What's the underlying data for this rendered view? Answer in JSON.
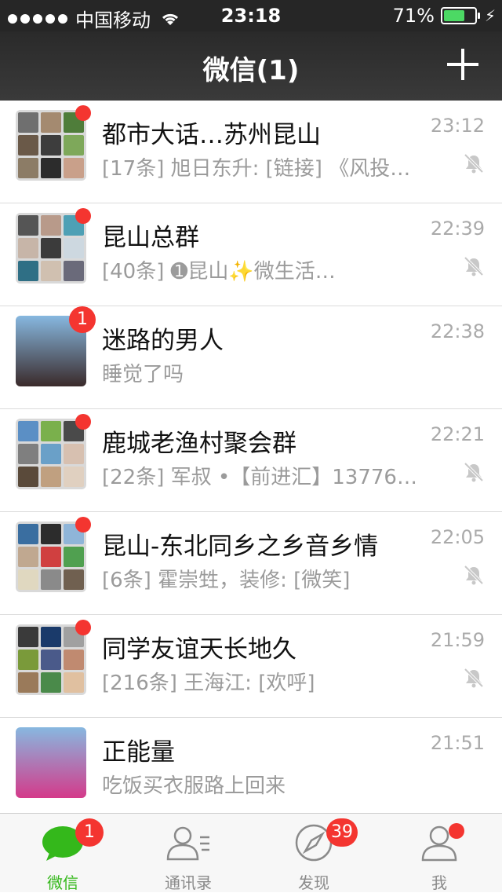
{
  "status_bar": {
    "carrier": "中国移动",
    "time": "23:18",
    "battery": "71%",
    "battery_level": 0.71
  },
  "nav": {
    "title": "微信(1)"
  },
  "chats": [
    {
      "title": "都市大话…苏州昆山",
      "preview": "[17条] 旭日东升: [链接] 《风投…",
      "time": "23:12",
      "badge": "dot",
      "muted": true,
      "avatar_colors": [
        "#6f6f6f",
        "#a48a70",
        "#4f7d3a",
        "#6a5948",
        "#3d3d3d",
        "#7ea85a",
        "#8c7c66",
        "#2c2c2c",
        "#c9a08a"
      ]
    },
    {
      "title": "昆山总群",
      "preview": "[40条] ➊昆山✨微生活…",
      "time": "22:39",
      "badge": "dot",
      "muted": true,
      "avatar_colors": [
        "#555",
        "#b89a8a",
        "#4ea0b5",
        "#c7b5a8",
        "#3b3b3b",
        "#cdd8e0",
        "#2f6f85",
        "#d0c0b0",
        "#6a6a7a"
      ]
    },
    {
      "title": "迷路的男人",
      "preview": "睡觉了吗",
      "time": "22:38",
      "badge": "1",
      "muted": false,
      "avatar_colors": [
        "#3a2a2a"
      ]
    },
    {
      "title": "鹿城老渔村聚会群",
      "preview": "[22条] 军叔 •【前进汇】13776…",
      "time": "22:21",
      "badge": "dot",
      "muted": true,
      "avatar_colors": [
        "#5b8fc5",
        "#7ab04c",
        "#4a4a4a",
        "#7f7f7f",
        "#6aa0c8",
        "#d7c0b0",
        "#5a4a3a",
        "#c0a080",
        "#e0d0c0"
      ]
    },
    {
      "title": "昆山-东北同乡之乡音乡情",
      "preview": "[6条] 霍崇甡，装修: [微笑]",
      "time": "22:05",
      "badge": "dot",
      "muted": true,
      "avatar_colors": [
        "#3a6ea0",
        "#2c2c2c",
        "#8fb5d8",
        "#c0a890",
        "#d04040",
        "#50a050",
        "#e0d8c0",
        "#8a8a8a",
        "#706050"
      ]
    },
    {
      "title": "同学友谊天长地久",
      "preview": "[216条] 王海江: [欢呼]",
      "time": "21:59",
      "badge": "dot",
      "muted": true,
      "avatar_colors": [
        "#3a3a3a",
        "#1a3a6a",
        "#a0a0a0",
        "#7a9a3a",
        "#4a5a8a",
        "#c08a70",
        "#9a7a5a",
        "#4a8a4a",
        "#e0c0a0"
      ]
    },
    {
      "title": "正能量",
      "preview": "吃饭买衣服路上回来",
      "time": "21:51",
      "badge": "none",
      "muted": false,
      "avatar_colors": [
        "#d43a8a"
      ]
    }
  ],
  "tabs": [
    {
      "label": "微信",
      "icon": "chat-bubble-icon",
      "badge": "1",
      "active": true
    },
    {
      "label": "通讯录",
      "icon": "contacts-icon",
      "badge": "",
      "active": false
    },
    {
      "label": "发现",
      "icon": "compass-icon",
      "badge": "39",
      "active": false
    },
    {
      "label": "我",
      "icon": "profile-icon",
      "badge": "dot",
      "active": false
    }
  ],
  "colors": {
    "accent": "#34b81b",
    "badge": "#f43530",
    "nav_bg": "#2e2e2e"
  }
}
